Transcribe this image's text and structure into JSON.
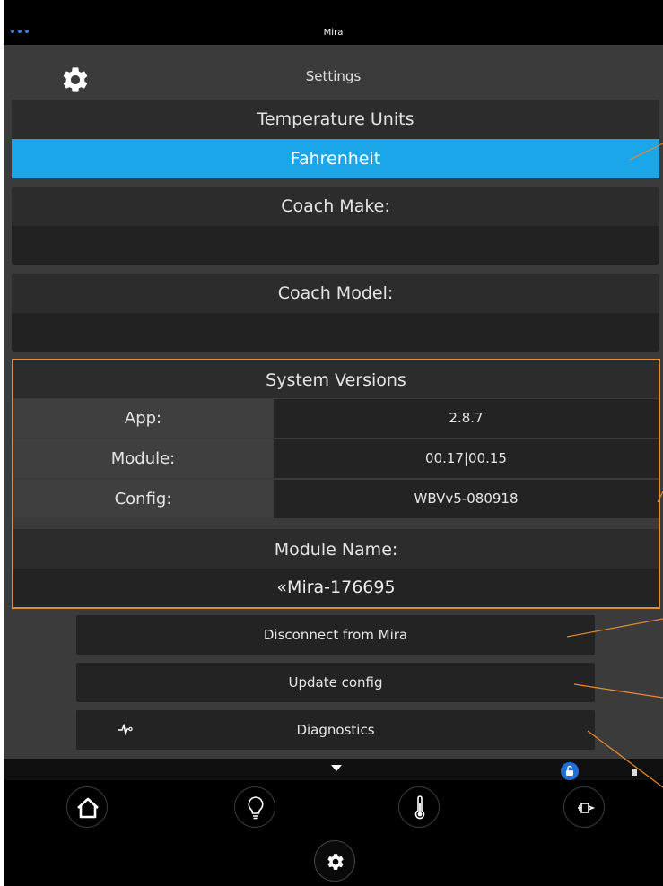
{
  "app": {
    "title": "Mira"
  },
  "header": {
    "title": "Settings",
    "icon": "gear-icon"
  },
  "temperature": {
    "header": "Temperature Units",
    "selected": "Fahrenheit"
  },
  "coach_make": {
    "header": "Coach Make:",
    "value": ""
  },
  "coach_model": {
    "header": "Coach Model:",
    "value": ""
  },
  "system_versions": {
    "header": "System Versions",
    "rows": [
      {
        "label": "App:",
        "value": "2.8.7"
      },
      {
        "label": "Module:",
        "value": "00.17|00.15"
      },
      {
        "label": "Config:",
        "value": "WBVv5-080918"
      }
    ],
    "module_name_header": "Module Name:",
    "module_name_value": "«Mira-176695",
    "highlight_color": "#e98b2d"
  },
  "actions": {
    "disconnect": "Disconnect from Mira",
    "update_config": "Update config",
    "diagnostics": "Diagnostics"
  },
  "nav": {
    "items": [
      "home-icon",
      "lightbulb-icon",
      "thermometer-icon",
      "power-plug-icon",
      "gear-icon"
    ],
    "active": "settings"
  },
  "colors": {
    "accent": "#1ba6e9",
    "background": "#3b3b3b",
    "annotation": "#e98b2d"
  }
}
